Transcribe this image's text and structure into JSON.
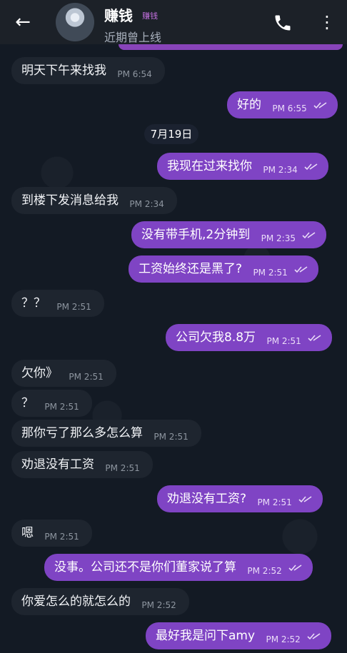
{
  "header": {
    "title": "赚钱",
    "subtitle_tag": "赚钱",
    "status": "近期曾上线"
  },
  "chat": {
    "date_separator": "7月19日",
    "messages": [
      {
        "text": "明天下午来找我",
        "time": "PM 6:54",
        "direction": "in"
      },
      {
        "text": "好的",
        "time": "PM 6:55",
        "direction": "out"
      },
      {
        "text": "我现在过来找你",
        "time": "PM 2:34",
        "direction": "out"
      },
      {
        "text": "到楼下发消息给我",
        "time": "PM 2:34",
        "direction": "in"
      },
      {
        "text": "没有带手机,2分钟到",
        "time": "PM 2:35",
        "direction": "out"
      },
      {
        "text": "工资始终还是黑了?",
        "time": "PM 2:51",
        "direction": "out"
      },
      {
        "text": "？？",
        "time": "PM 2:51",
        "direction": "in"
      },
      {
        "text": "公司欠我8.8万",
        "time": "PM 2:51",
        "direction": "out"
      },
      {
        "text": "欠你》",
        "time": "PM 2:51",
        "direction": "in"
      },
      {
        "text": "？",
        "time": "PM 2:51",
        "direction": "in"
      },
      {
        "text": "那你亏了那么多怎么算",
        "time": "PM 2:51",
        "direction": "in"
      },
      {
        "text": "劝退没有工资",
        "time": "PM 2:51",
        "direction": "in"
      },
      {
        "text": "劝退没有工资?",
        "time": "PM 2:51",
        "direction": "out"
      },
      {
        "text": "嗯",
        "time": "PM 2:51",
        "direction": "in"
      },
      {
        "text": "没事。公司还不是你们董家说了算",
        "time": "PM 2:52",
        "direction": "out"
      },
      {
        "text": "你爱怎么的就怎么的",
        "time": "PM 2:52",
        "direction": "in"
      },
      {
        "text": "最好我是问下amy",
        "time": "PM 2:52",
        "direction": "out"
      }
    ]
  }
}
